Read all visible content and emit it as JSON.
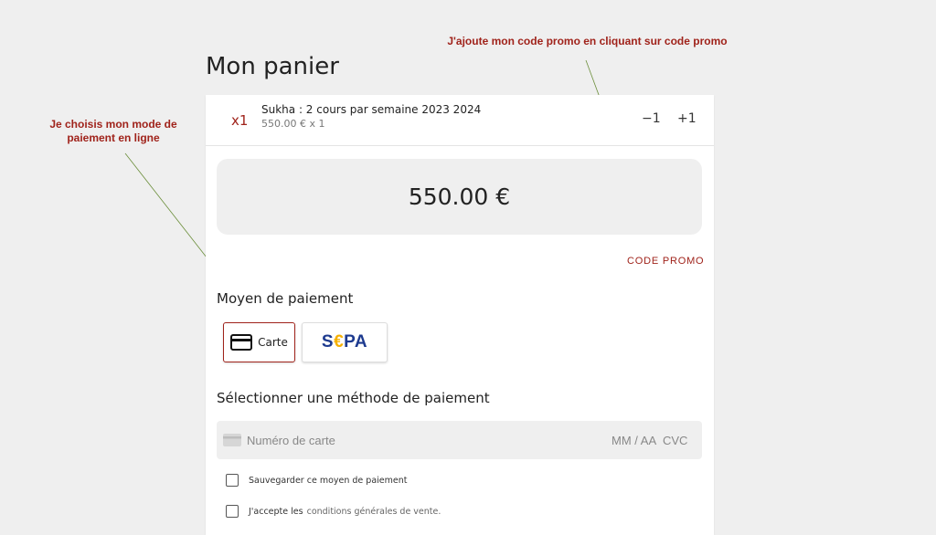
{
  "page": {
    "title": "Mon panier"
  },
  "annotations": {
    "left": "Je choisis mon mode de paiement en ligne",
    "right": "J'ajoute mon code promo en cliquant sur code promo"
  },
  "cart": {
    "item": {
      "quantity": "x1",
      "name": "Sukha : 2 cours par semaine 2023 2024",
      "price_line": "550.00 € x 1",
      "decrement_label": "−1",
      "increment_label": "+1"
    },
    "total": "550.00 €",
    "promo_label": "CODE PROMO"
  },
  "payment": {
    "heading": "Moyen de paiement",
    "methods": {
      "card_label": "Carte",
      "sepa_prefix": "S",
      "sepa_euro": "€",
      "sepa_suffix": "PA"
    },
    "select_heading": "Sélectionner une méthode de paiement",
    "card_field": {
      "placeholder": "Numéro de carte",
      "expiry_placeholder": "MM / AA",
      "cvc_placeholder": "CVC"
    },
    "save_label": "Sauvegarder ce moyen de paiement",
    "accept_label": "J'accepte les",
    "terms_link": "conditions générales de vente."
  },
  "colors": {
    "accent": "#a0231b",
    "background": "#efefef",
    "sepa_blue": "#1d3a8f",
    "sepa_yellow": "#f6b000",
    "arrow": "#6b8e3a"
  }
}
